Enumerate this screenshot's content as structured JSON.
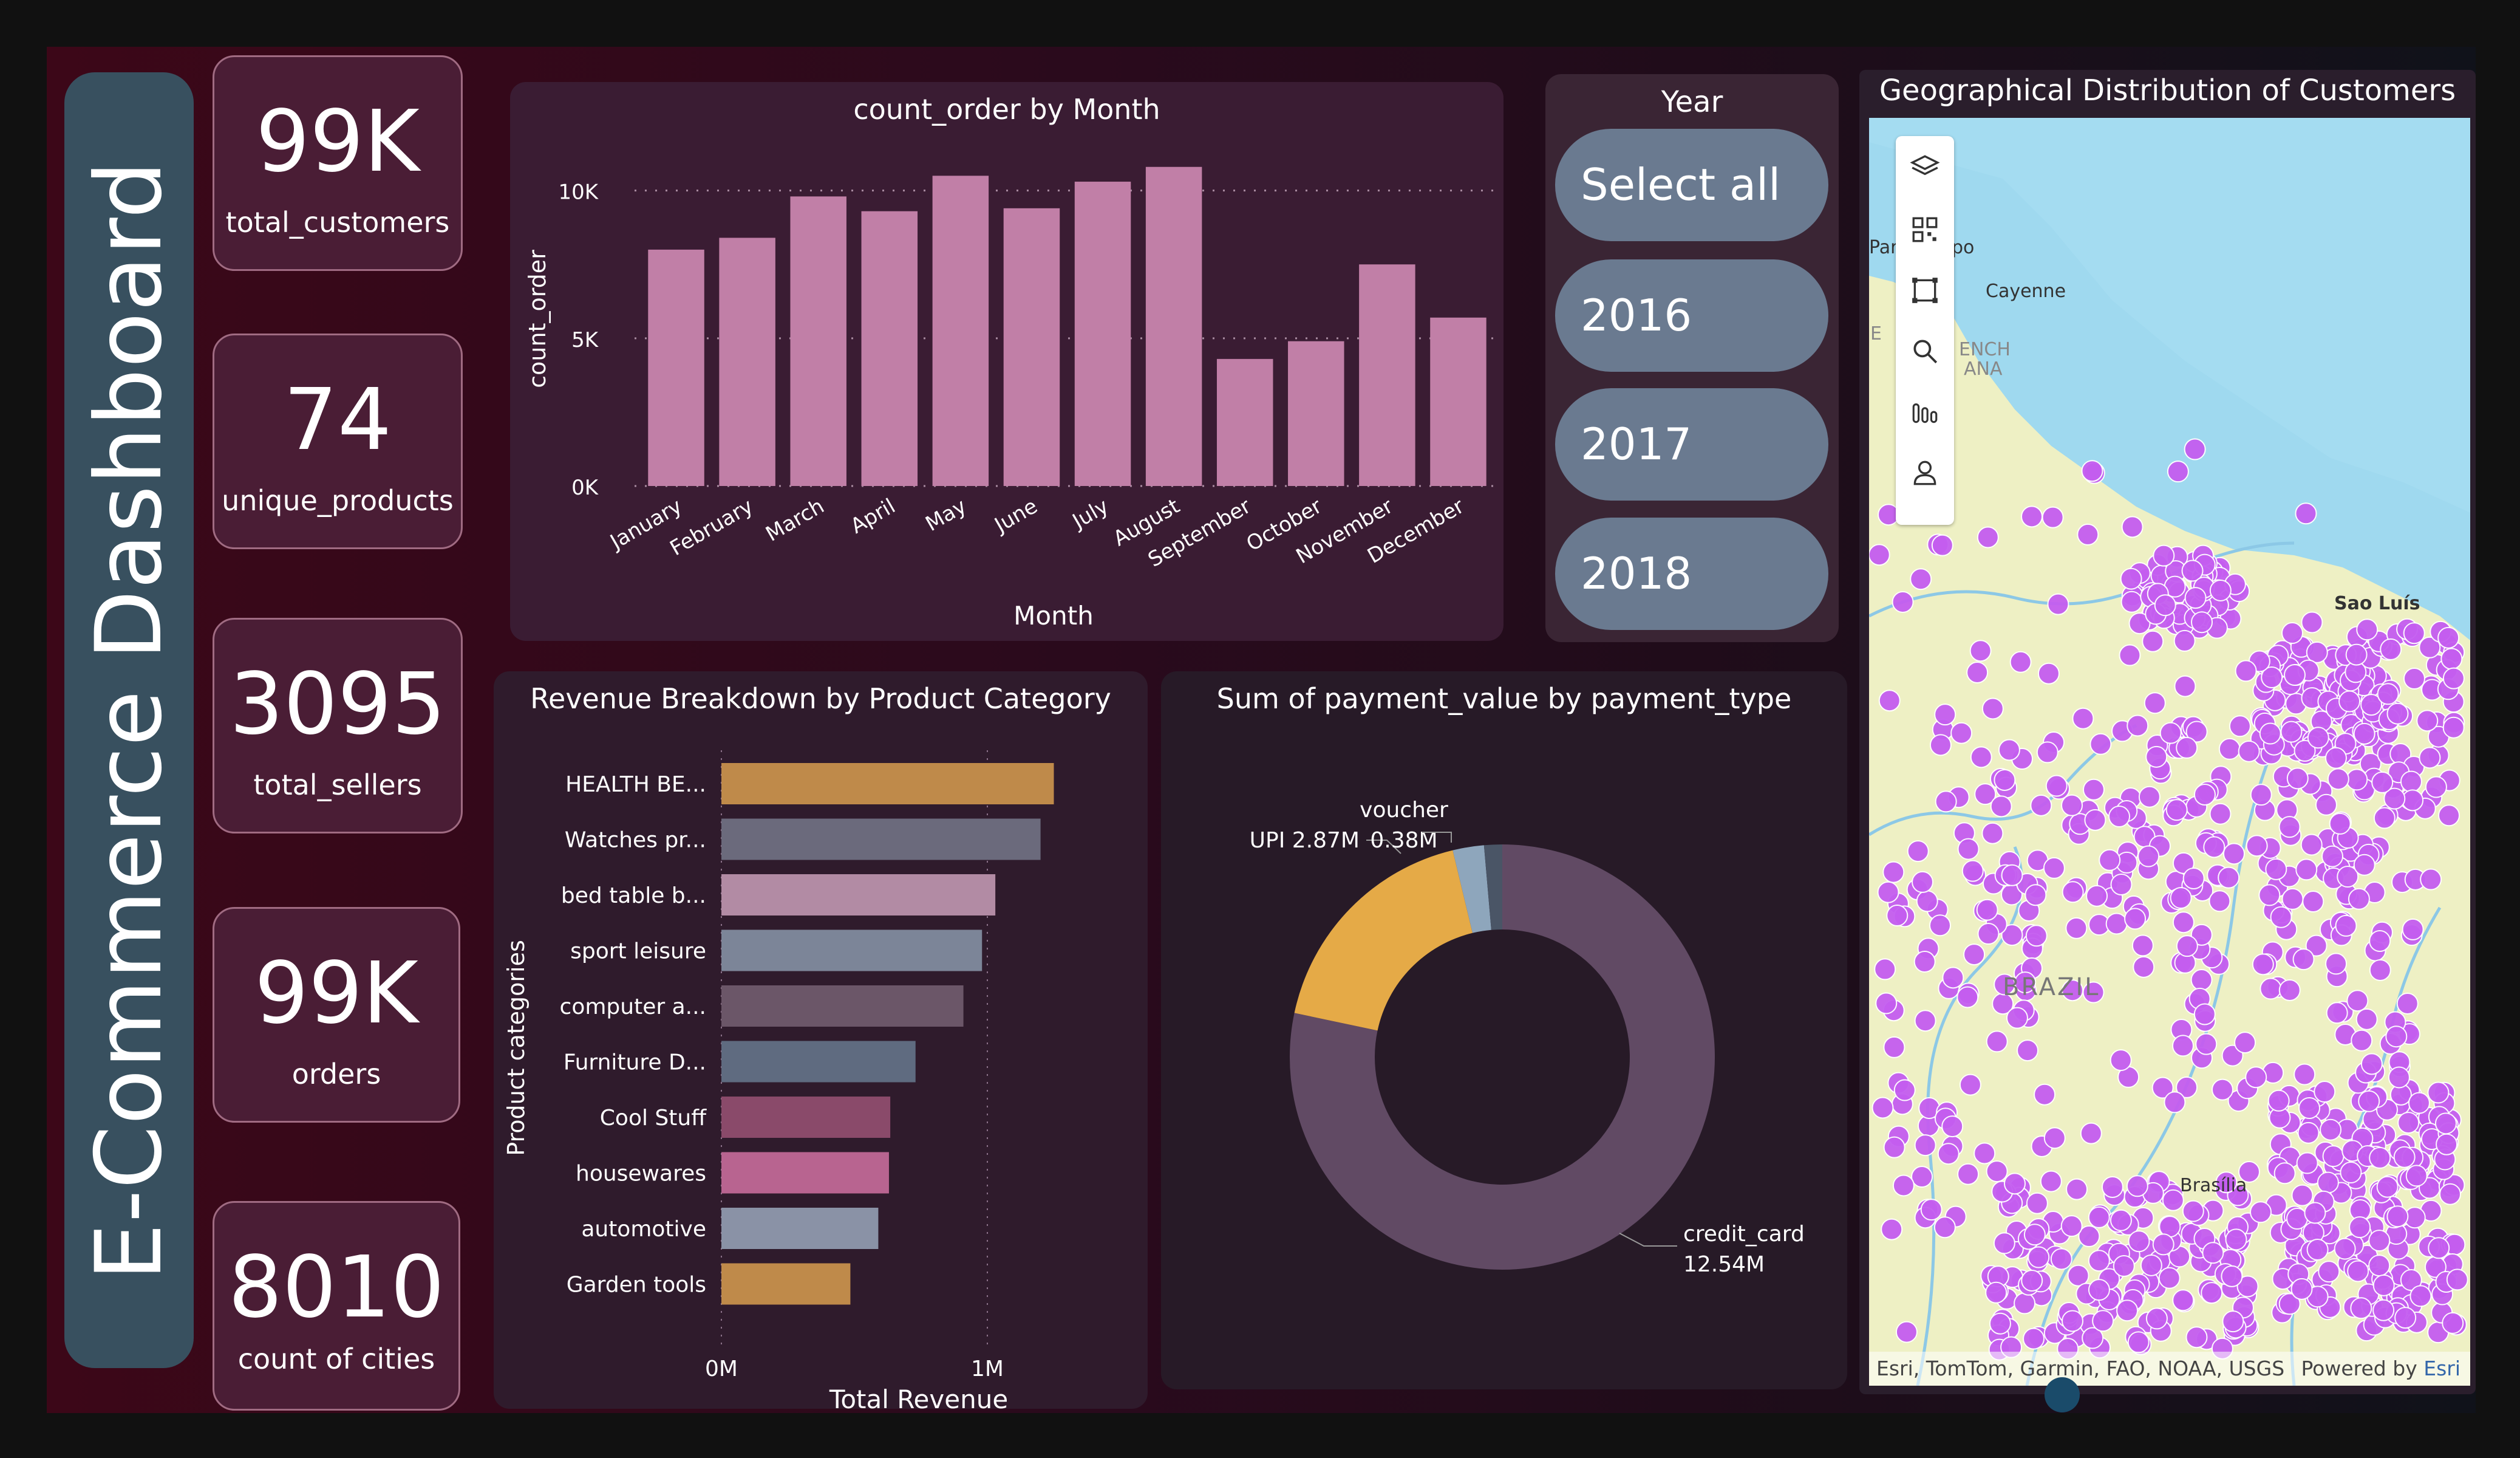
{
  "dashboard": {
    "title": "E-Commerce Dashboard"
  },
  "kpis": [
    {
      "value": "99K",
      "label": "total_customers"
    },
    {
      "value": "74",
      "label": "unique_products"
    },
    {
      "value": "3095",
      "label": "total_sellers"
    },
    {
      "value": "99K",
      "label": "orders"
    },
    {
      "value": "8010",
      "label": "count of cities"
    }
  ],
  "year_slicer": {
    "title": "Year",
    "options": [
      "Select all",
      "2016",
      "2017",
      "2018"
    ]
  },
  "colors": {
    "bar_pink": "#c17fa7",
    "slicer_button": "#6a7a90",
    "donut_credit": "#614a64",
    "donut_upi": "#e5aa47",
    "donut_voucher": "#8ea6bc",
    "map_dot": "#c45df0"
  },
  "chart_data": [
    {
      "type": "bar",
      "title": "count_order by Month",
      "xlabel": "Month",
      "ylabel": "count_order",
      "categories": [
        "January",
        "February",
        "March",
        "April",
        "May",
        "June",
        "July",
        "August",
        "September",
        "October",
        "November",
        "December"
      ],
      "values": [
        8000,
        8400,
        9800,
        9300,
        10500,
        9400,
        10300,
        10800,
        4300,
        4900,
        7500,
        5700
      ],
      "ylim": [
        0,
        11000
      ],
      "yticks": [
        "0K",
        "5K",
        "10K"
      ],
      "grid": true
    },
    {
      "type": "bar",
      "orientation": "horizontal",
      "title": "Revenue Breakdown by Product Category",
      "xlabel": "Total Revenue",
      "ylabel": "Product categories",
      "categories": [
        "HEALTH BE...",
        "Watches pr...",
        "bed table b...",
        "sport leisure",
        "computer a...",
        "Furniture D...",
        "Cool Stuff",
        "housewares",
        "automotive",
        "Garden tools"
      ],
      "values": [
        1250000,
        1200000,
        1030000,
        980000,
        910000,
        730000,
        635000,
        630000,
        590000,
        485000
      ],
      "bar_colors": [
        "#bf8a4a",
        "#6b6a7c",
        "#b28ba4",
        "#7c8598",
        "#6b5668",
        "#5f6b80",
        "#8a4a6a",
        "#b86490",
        "#8a92a6",
        "#bf8a4a"
      ],
      "xticks": [
        "0M",
        "1M"
      ],
      "xlim": [
        0,
        1400000
      ]
    },
    {
      "type": "pie",
      "donut": true,
      "title": "Sum of payment_value by payment_type",
      "slices": [
        {
          "label": "credit_card",
          "value_label": "12.54M",
          "value": 12.54
        },
        {
          "label": "UPI",
          "value_label": "2.87M",
          "value": 2.87
        },
        {
          "label": "voucher",
          "value_label": "0.38M",
          "value": 0.38
        },
        {
          "label": "",
          "value_label": "",
          "value": 0.22
        }
      ]
    }
  ],
  "map": {
    "title": "Geographical Distribution of Customers",
    "labels": [
      "Cayenne",
      "Sao Luís",
      "BRAZIL",
      "Brasília",
      "Par",
      "po",
      "ENCH",
      "ANA",
      "E"
    ],
    "attribution": "Esri, TomTom, Garmin, FAO, NOAA, USGS",
    "powered_by": "Powered by",
    "powered_by_brand": "Esri",
    "tools": [
      "layers-icon",
      "qr-icon",
      "select-rect-icon",
      "search-icon",
      "columns-icon",
      "user-icon"
    ]
  }
}
